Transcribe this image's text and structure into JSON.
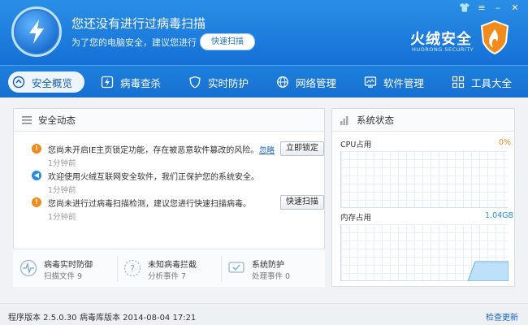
{
  "header": {
    "title": "您还没有进行过病毒扫描",
    "subtitle": "为了您的电脑安全，建议您进行",
    "quick_scan": "快速扫描",
    "brand": "火绒安全",
    "brand_sub": "HUORONG SECURITY"
  },
  "nav": [
    {
      "label": "安全概览",
      "icon": "home-icon"
    },
    {
      "label": "病毒查杀",
      "icon": "bolt-icon"
    },
    {
      "label": "实时防护",
      "icon": "shield-icon"
    },
    {
      "label": "网络管理",
      "icon": "globe-icon"
    },
    {
      "label": "软件管理",
      "icon": "monitor-icon"
    },
    {
      "label": "工具大全",
      "icon": "grid-icon"
    }
  ],
  "security_news": {
    "title": "安全动态",
    "items": [
      {
        "message": "您尚未开启IE主页锁定功能，存在被恶意软件篡改的风险。",
        "time": "1分钟前",
        "action": "立即锁定",
        "link": "忽略",
        "color": "#f08b1c",
        "icon": "warning-icon"
      },
      {
        "message": "欢迎使用火绒互联网安全软件，我们正保护您的系统安全。",
        "time": "1分钟前",
        "color": "#2d8ae0",
        "icon": "speaker-icon"
      },
      {
        "message": "您尚未进行过病毒扫描检测，建议您进行快速扫描病毒。",
        "time": "1分钟前",
        "action": "快速扫描",
        "color": "#f08b1c",
        "icon": "warning-icon"
      }
    ]
  },
  "stats": [
    {
      "title": "病毒实时防御",
      "value": "扫描文件 9",
      "icon": "pulse-icon"
    },
    {
      "title": "未知病毒拦截",
      "value": "分析事件 7",
      "icon": "question-icon"
    },
    {
      "title": "系统防护",
      "value": "处理事件 0",
      "icon": "screen-icon"
    }
  ],
  "system_status": {
    "title": "系统状态",
    "cpu_label": "CPU占用",
    "cpu_value": "0%",
    "mem_label": "内存占用",
    "mem_value": "1.04GB"
  },
  "footer": {
    "program_version": "程序版本 2.5.0.30",
    "db_version": "病毒库版本 2014-08-04 17:21",
    "check_update": "检查更新"
  },
  "colors": {
    "header_blue": "#1f7fdc",
    "accent_orange": "#f08b1c",
    "link_blue": "#1a64c8"
  }
}
